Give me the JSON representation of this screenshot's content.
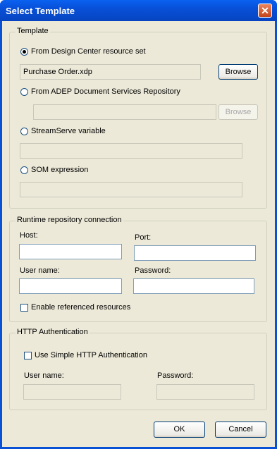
{
  "title": "Select Template",
  "close_glyph": "✕",
  "template": {
    "legend": "Template",
    "radio_design_center": "From Design Center resource set",
    "resource_value": "Purchase Order.xdp",
    "browse1": "Browse",
    "radio_adep": "From ADEP Document Services Repository",
    "browse2": "Browse",
    "radio_streamserve": "StreamServe variable",
    "radio_som": "SOM expression"
  },
  "runtime": {
    "legend": "Runtime repository connection",
    "host_label": "Host:",
    "port_label": "Port:",
    "user_label": "User name:",
    "password_label": "Password:",
    "enable_label": "Enable referenced resources"
  },
  "http": {
    "legend": "HTTP Authentication",
    "use_simple_label": "Use Simple HTTP Authentication",
    "user_label": "User name:",
    "password_label": "Password:"
  },
  "buttons": {
    "ok": "OK",
    "cancel": "Cancel"
  }
}
